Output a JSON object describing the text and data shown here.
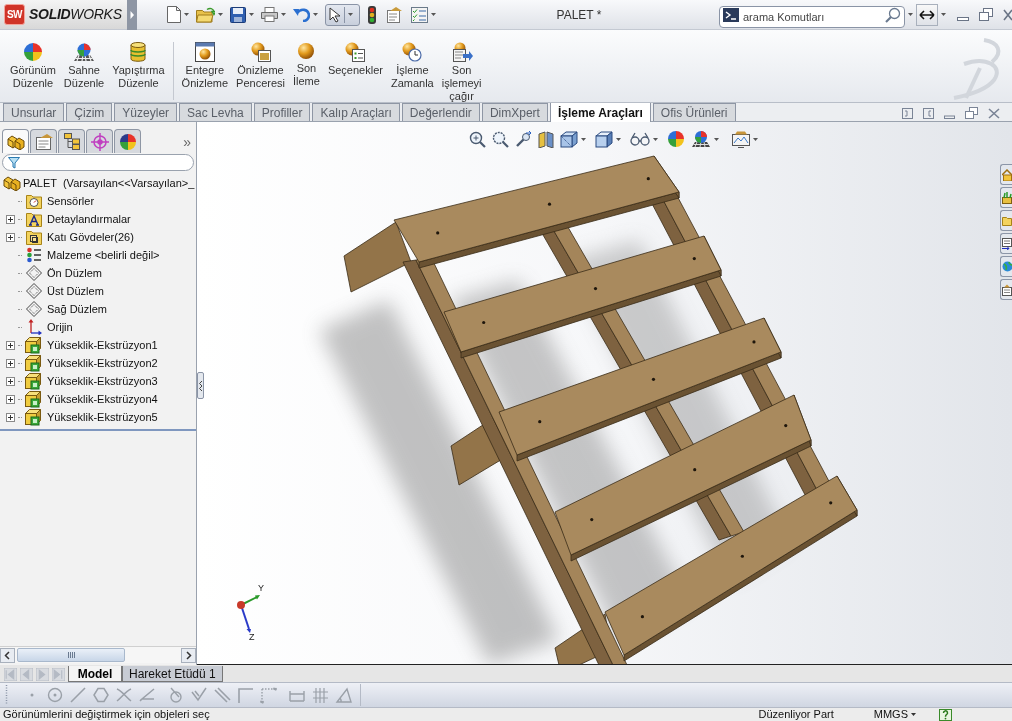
{
  "title_bar": {
    "logo_badge": "SW",
    "logo": "**SOLID**WORKS",
    "document_title": "PALET *",
    "search": {
      "placeholder": "arama Komutları"
    }
  },
  "ribbon": {
    "groups": [
      {
        "buttons": [
          {
            "lines": [
              "Görünüm",
              "Düzenle"
            ]
          },
          {
            "lines": [
              "Sahne",
              "Düzenle"
            ]
          },
          {
            "lines": [
              "Yapıştırma",
              "Düzenle"
            ]
          }
        ]
      },
      {
        "buttons": [
          {
            "lines": [
              "Entegre",
              "Önizleme"
            ]
          },
          {
            "lines": [
              "Önizleme",
              "Penceresi"
            ]
          },
          {
            "lines": [
              "Son",
              "İleme"
            ]
          },
          {
            "lines": [
              "Seçenekler"
            ]
          },
          {
            "lines": [
              "İşleme",
              "Zamanla"
            ]
          },
          {
            "lines": [
              "Son",
              "işlemeyi",
              "çağır"
            ]
          }
        ]
      }
    ]
  },
  "command_tabs": [
    {
      "label": "Unsurlar",
      "selected": false
    },
    {
      "label": "Çizim",
      "selected": false
    },
    {
      "label": "Yüzeyler",
      "selected": false
    },
    {
      "label": "Sac Levha",
      "selected": false
    },
    {
      "label": "Profiller",
      "selected": false
    },
    {
      "label": "Kalıp Araçları",
      "selected": false
    },
    {
      "label": "Değerlendir",
      "selected": false
    },
    {
      "label": "DimXpert",
      "selected": false
    },
    {
      "label": "İşleme Araçları",
      "selected": true
    },
    {
      "label": "Ofis Ürünleri",
      "selected": false
    }
  ],
  "feature_manager": {
    "panel_tabs": [
      {
        "selected": true
      },
      {
        "selected": false
      },
      {
        "selected": false
      },
      {
        "selected": false
      },
      {
        "selected": false
      }
    ],
    "more": "»",
    "tree": {
      "label": "PALET  (Varsayılan<<Varsayılan>_",
      "children": [
        {
          "label": "Sensörler",
          "kind": "sensors",
          "expandable": false
        },
        {
          "label": "Detaylandırmalar",
          "kind": "annotations",
          "expandable": true
        },
        {
          "label": "Katı Gövdeler(26)",
          "kind": "solid-bodies",
          "expandable": true
        },
        {
          "label": "Malzeme <belirli değil>",
          "kind": "material",
          "expandable": false
        },
        {
          "label": "Ön Düzlem",
          "kind": "plane",
          "expandable": false
        },
        {
          "label": "Üst Düzlem",
          "kind": "plane",
          "expandable": false
        },
        {
          "label": "Sağ Düzlem",
          "kind": "plane",
          "expandable": false
        },
        {
          "label": "Orijin",
          "kind": "origin",
          "expandable": false
        },
        {
          "label": "Yükseklik-Ekstrüzyon1",
          "kind": "extrude",
          "expandable": true
        },
        {
          "label": "Yükseklik-Ekstrüzyon2",
          "kind": "extrude",
          "expandable": true
        },
        {
          "label": "Yükseklik-Ekstrüzyon3",
          "kind": "extrude",
          "expandable": true
        },
        {
          "label": "Yükseklik-Ekstrüzyon4",
          "kind": "extrude",
          "expandable": true
        },
        {
          "label": "Yükseklik-Ekstrüzyon5",
          "kind": "extrude",
          "expandable": true
        }
      ]
    }
  },
  "viewport": {
    "triad": {
      "y_label": "Y",
      "z_label": "Z"
    }
  },
  "bottom_tabs": [
    {
      "label": "Model",
      "selected": true
    },
    {
      "label": "Hareket Etüdü 1",
      "selected": false
    }
  ],
  "status_bar": {
    "message": "Görünümlerini değiştirmek için objeleri seç",
    "mode": "Düzenliyor Part",
    "units": "MMGS"
  }
}
